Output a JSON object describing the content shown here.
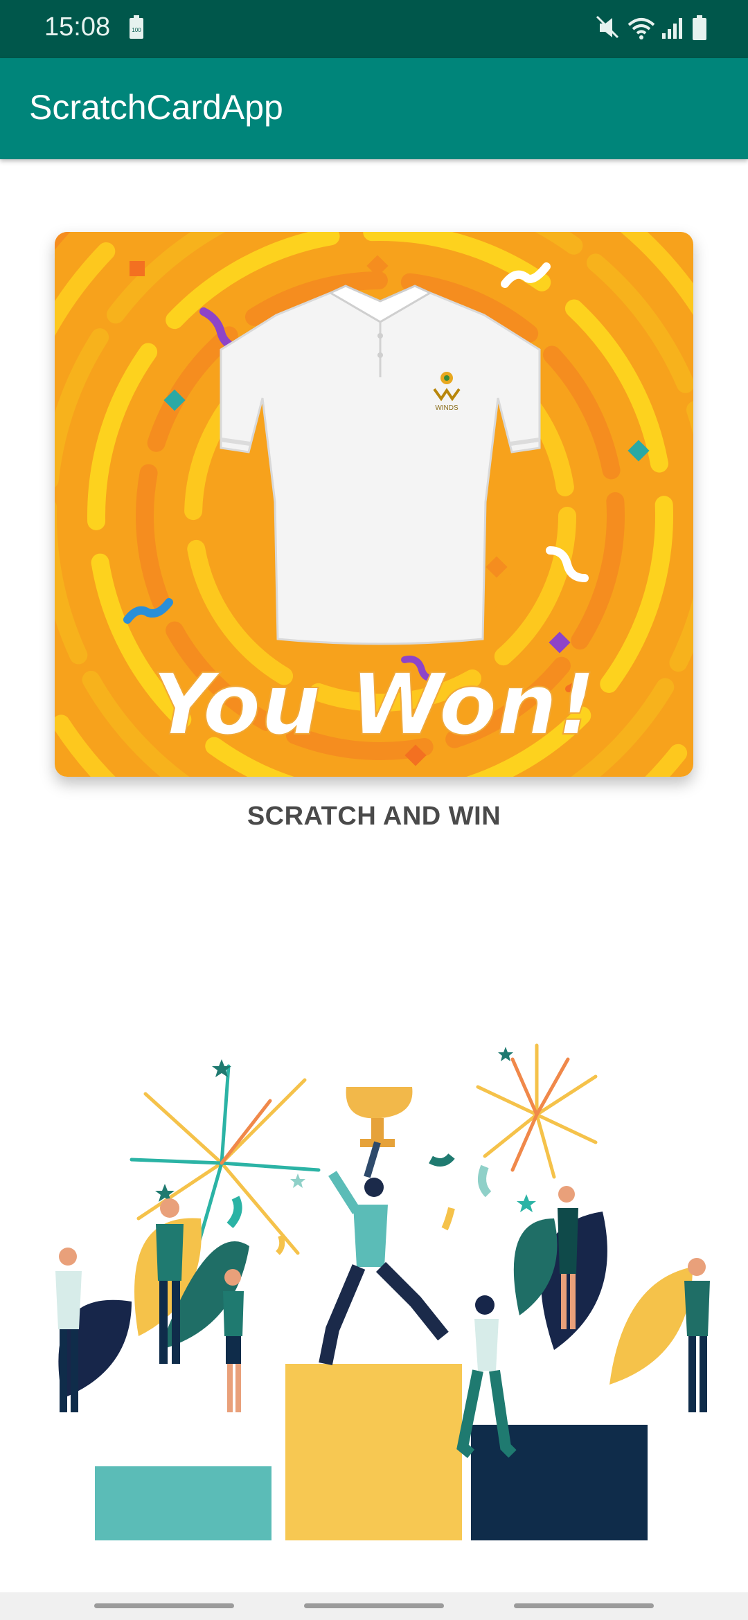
{
  "status_bar": {
    "time": "15:08",
    "battery_badge": "100",
    "icons": [
      "mute-icon",
      "wifi-icon",
      "signal-icon",
      "battery-icon"
    ]
  },
  "app_bar": {
    "title": "ScratchCardApp",
    "color": "#00857a"
  },
  "scratch_card": {
    "headline": "You Won!",
    "prize_logo_text": "WINDS",
    "label": "SCRATCH AND WIN"
  },
  "nav_bar": {
    "handles": 3
  },
  "colors": {
    "status_bar": "#00574b",
    "primary": "#00857a",
    "card_orange": "#f7a21c",
    "card_yellow": "#fdc81e",
    "label_text": "#4a4a4a"
  }
}
